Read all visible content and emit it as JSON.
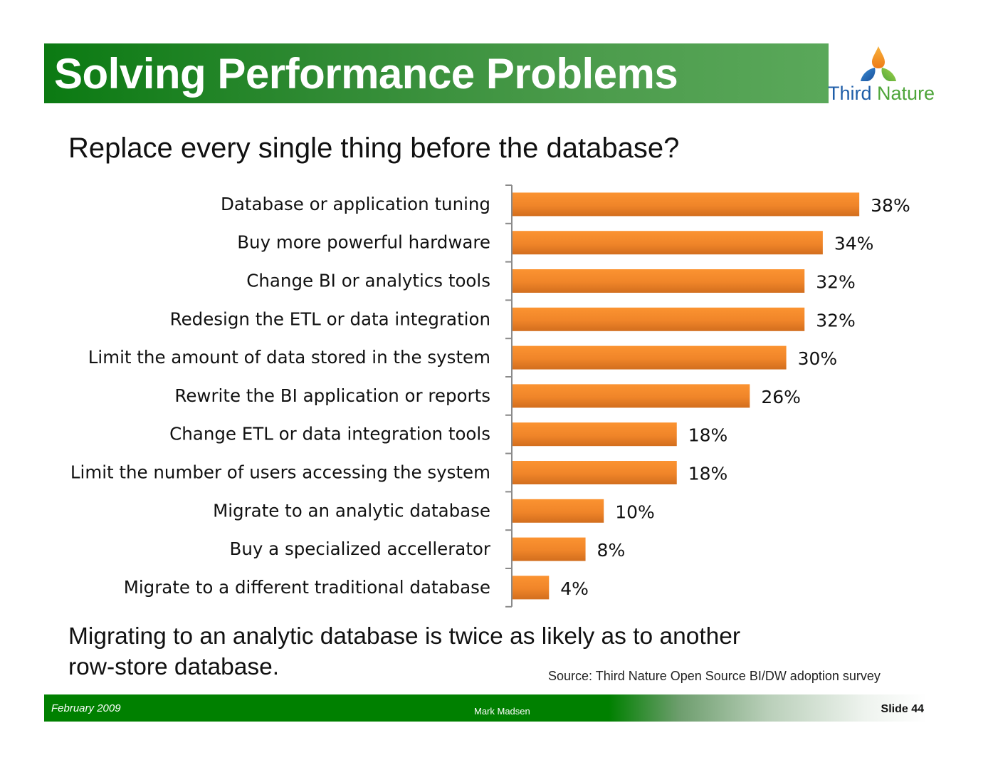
{
  "slide": {
    "title": "Solving Performance Problems",
    "subtitle": "Replace every single thing before the database?",
    "conclusion_line1": "Migrating to an analytic database is twice as likely as to another",
    "conclusion_line2": "row-store database.",
    "source": "Source: Third Nature Open Source BI/DW adoption survey"
  },
  "logo": {
    "word1": "Third",
    "word2": "Nature",
    "icon": "three-drops-logo-icon"
  },
  "footer": {
    "date": "February 2009",
    "author": "Mark Madsen",
    "slide_number": "Slide 44"
  },
  "colors": {
    "title_green": "#0b7a12",
    "bar_orange": "#f28a2b",
    "bar_orange_dark": "#d9701c",
    "logo_blue": "#1f5ea8",
    "logo_green": "#4ea53a",
    "logo_orange": "#f29124"
  },
  "chart_data": {
    "type": "bar",
    "orientation": "horizontal",
    "title": "Replace every single thing before the database?",
    "xlabel": "",
    "ylabel": "",
    "xlim": [
      0,
      40
    ],
    "grid": false,
    "legend": "none",
    "value_format": "percent",
    "categories": [
      "Database or application tuning",
      "Buy more powerful hardware",
      "Change BI or analytics tools",
      "Redesign the ETL or data integration",
      "Limit the amount of data stored in the system",
      "Rewrite the BI application or reports",
      "Change ETL or data integration tools",
      "Limit the number of users accessing the system",
      "Migrate to an analytic database",
      "Buy a specialized accellerator",
      "Migrate to a different traditional database"
    ],
    "values": [
      38,
      34,
      32,
      32,
      30,
      26,
      18,
      18,
      10,
      8,
      4
    ],
    "data_labels": [
      "38%",
      "34%",
      "32%",
      "32%",
      "30%",
      "26%",
      "18%",
      "18%",
      "10%",
      "8%",
      "4%"
    ]
  }
}
